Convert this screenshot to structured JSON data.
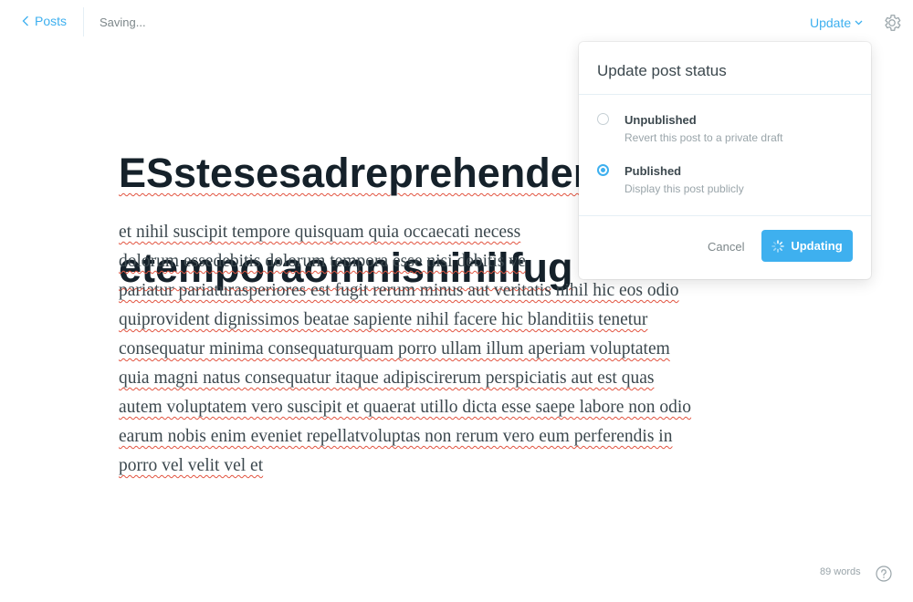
{
  "topbar": {
    "back_label": "Posts",
    "save_status": "Saving...",
    "update_label": "Update"
  },
  "editor": {
    "title_lines": [
      "ESstesesadreprehender",
      "etemporaomnisnihilfug"
    ],
    "body_lines": [
      "et nihil suscipit tempore quisquam quia occaecati necess",
      "dolorum essedebitis dolorum tempora esse nisi debitis ve",
      "pariatur pariaturasperiores est fugit rerum minus aut veritatis nihil hic eos odio",
      "quiprovident dignissimos beatae sapiente nihil facere hic blanditiis tenetur",
      "consequatur minima consequaturquam porro ullam illum aperiam voluptatem",
      "quia magni natus consequatur itaque adipiscirerum perspiciatis aut est quas",
      "autem voluptatem vero suscipit et quaerat utillo dicta esse saepe labore non odio",
      "earum nobis enim eveniet repellatvoluptas non rerum vero eum perferendis in",
      "porro vel velit vel et"
    ]
  },
  "popover": {
    "title": "Update post status",
    "options": [
      {
        "label": "Unpublished",
        "description": "Revert this post to a private draft",
        "selected": false
      },
      {
        "label": "Published",
        "description": "Display this post publicly",
        "selected": true
      }
    ],
    "cancel_label": "Cancel",
    "updating_label": "Updating"
  },
  "footer": {
    "word_count": "89 words"
  },
  "icons": {
    "back": "chevron-left-icon",
    "dropdown": "chevron-down-icon",
    "settings": "gear-icon",
    "spinner": "spinner-icon",
    "help": "question-circle-icon"
  },
  "colors": {
    "accent": "#3eb0ef",
    "text": "#15212a",
    "muted": "#7d878a",
    "spellcheck": "#e25440"
  }
}
